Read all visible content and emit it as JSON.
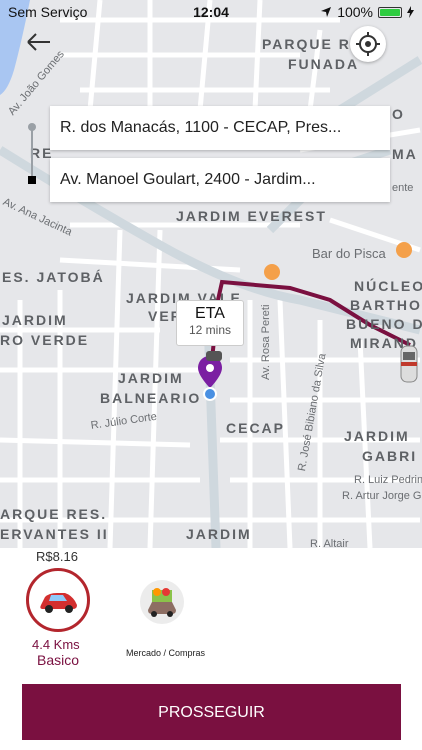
{
  "status_bar": {
    "carrier": "Sem Serviço",
    "time": "12:04",
    "battery": "100%",
    "battery_level": 1.0
  },
  "map": {
    "labels": {
      "parque": "PARQUE R",
      "funada": "FUNADA",
      "jardim_everest": "JARDIM EVEREST",
      "bar_do_pisca": "Bar do Pisca",
      "jatoba": "ES. JATOBÁ",
      "jardim_vale": "JARDIM VALE",
      "ver": "VER",
      "jardim": "JARDIM",
      "ro_verde": "RO VERDE",
      "nucleo": "NÚCLEO",
      "bartholo": "BARTHOLO",
      "bueno": "BUENO D",
      "mirand": "MIRAND",
      "jardim_balneario_1": "JARDIM",
      "jardim_balneario_2": "BALNEARIO",
      "cecap": "CECAP",
      "jardim_gabri_1": "JARDIM",
      "jardim_gabri_2": "GABRI",
      "arque_res": "ARQUE RES.",
      "servantes": "ERVANTES II",
      "jardim_bottom": "JARDIM",
      "ma": "MA",
      "o": "O",
      "ente": "ente",
      "re": "RE",
      "street_joao": "Av. João Gomes",
      "street_ana": "Av. Ana Jacinta",
      "street_rosa": "Av. Rosa Pereti",
      "street_jose": "R. José Bibiano da Silva",
      "street_julio": "R. Júlio Corte",
      "street_luiz": "R. Luiz Pedrini",
      "street_artur": "R. Artur Jorge Guazz",
      "street_altair": "R. Altair"
    }
  },
  "route": {
    "origin": "R. dos Manacás, 1100 - CECAP, Pres...",
    "destination": "Av. Manoel Goulart, 2400 - Jardim..."
  },
  "eta": {
    "title": "ETA",
    "value": "12 mins"
  },
  "ride_options": [
    {
      "price": "R$8.16",
      "distance": "4.4 Kms",
      "name": "Basico",
      "icon": "red-car-icon"
    },
    {
      "name": "Mercado / Compras",
      "icon": "grocery-car-icon"
    }
  ],
  "button": {
    "label": "PROSSEGUIR"
  },
  "colors": {
    "accent": "#7a1040",
    "selection_ring": "#b3262d",
    "route": "#7a1040",
    "pin": "#7b1fa2"
  }
}
